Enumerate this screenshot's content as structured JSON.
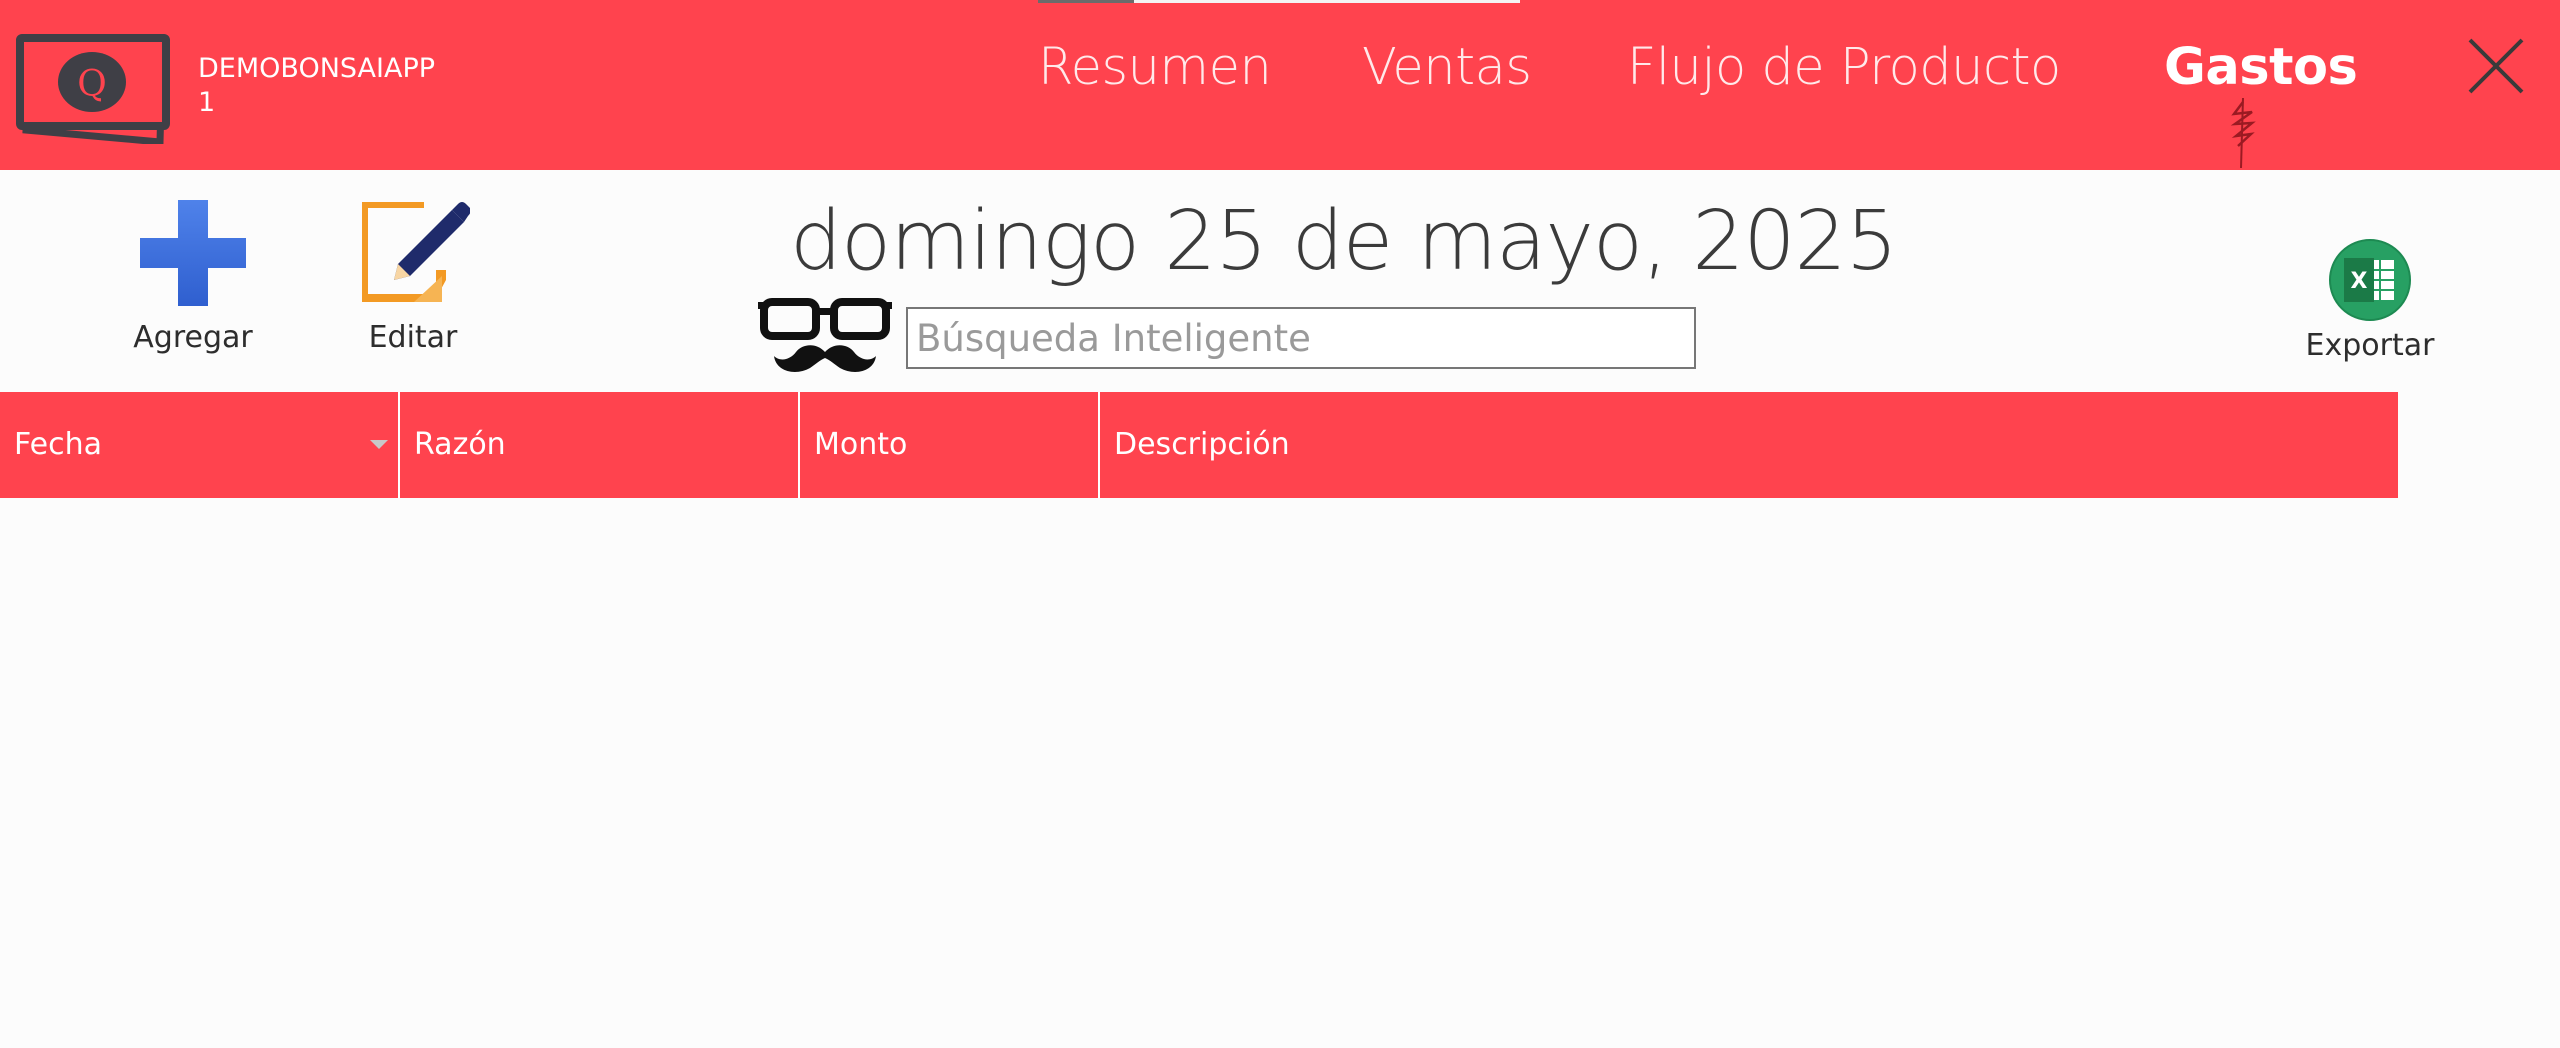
{
  "app": {
    "name": "DEMOBONSAIAPP\n1"
  },
  "nav": {
    "tabs": [
      {
        "label": "Resumen"
      },
      {
        "label": "Ventas"
      },
      {
        "label": "Flujo de Producto"
      },
      {
        "label": "Gastos",
        "active": true
      }
    ]
  },
  "toolbar": {
    "add_label": "Agregar",
    "edit_label": "Editar",
    "export_label": "Exportar"
  },
  "date_title": "domingo 25 de mayo, 2025",
  "search": {
    "placeholder": "Búsqueda Inteligente",
    "value": ""
  },
  "grid": {
    "columns": [
      "Fecha",
      "Razón",
      "Monto",
      "Descripción"
    ],
    "sorted_column": "Fecha",
    "rows": []
  },
  "colors": {
    "accent": "#ff434e",
    "header_text": "#ffffff",
    "add_icon": "#3c6fdc",
    "edit_icon": "#f39a24",
    "export_icon": "#27a063"
  },
  "icons": {
    "logo": "q-screen-logo-icon",
    "add": "plus-icon",
    "edit": "pencil-note-icon",
    "search": "glasses-mustache-icon",
    "export": "excel-icon",
    "close": "close-icon"
  }
}
